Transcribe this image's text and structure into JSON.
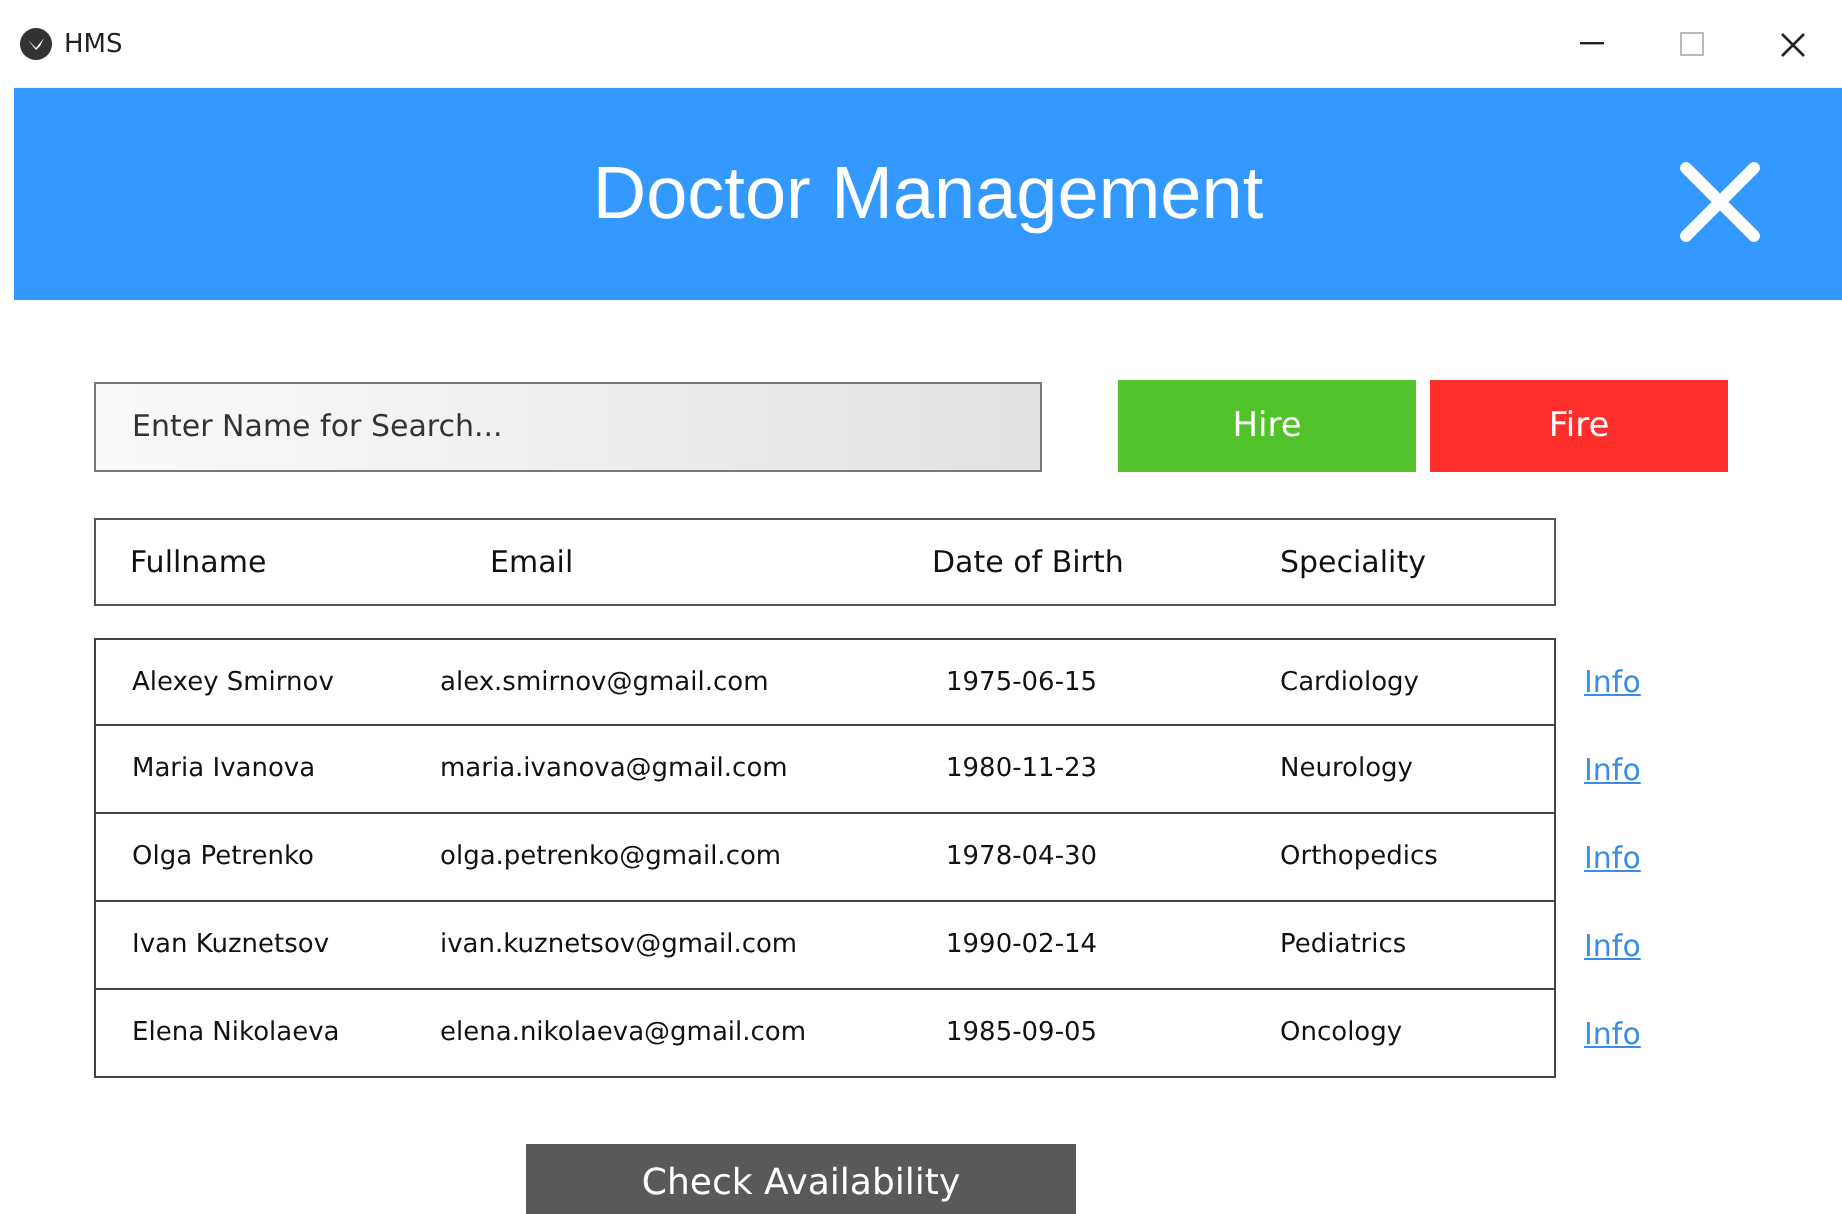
{
  "window": {
    "title": "HMS"
  },
  "header": {
    "title": "Doctor Management"
  },
  "search": {
    "placeholder": "Enter Name for Search..."
  },
  "buttons": [
    {
      "label": "Hire",
      "kind": "hire"
    },
    {
      "label": "Fire",
      "kind": "fire"
    }
  ],
  "table": {
    "columns": [
      "Fullname",
      "Email",
      "Date of Birth",
      "Speciality"
    ],
    "rows": [
      {
        "cells": [
          "Alexey Smirnov",
          "alex.smirnov@gmail.com",
          "1975-06-15",
          "Cardiology"
        ],
        "link": "Info"
      },
      {
        "cells": [
          "Maria Ivanova",
          "maria.ivanova@gmail.com",
          "1980-11-23",
          "Neurology"
        ],
        "link": "Info"
      },
      {
        "cells": [
          "Olga Petrenko",
          "olga.petrenko@gmail.com",
          "1978-04-30",
          "Orthopedics"
        ],
        "link": "Info"
      },
      {
        "cells": [
          "Ivan Kuznetsov",
          "ivan.kuznetsov@gmail.com",
          "1990-02-14",
          "Pediatrics"
        ],
        "link": "Info"
      },
      {
        "cells": [
          "Elena Nikolaeva",
          "elena.nikolaeva@gmail.com",
          "1985-09-05",
          "Oncology"
        ],
        "link": "Info"
      }
    ]
  },
  "footer_button": {
    "label": "Check Availability"
  }
}
